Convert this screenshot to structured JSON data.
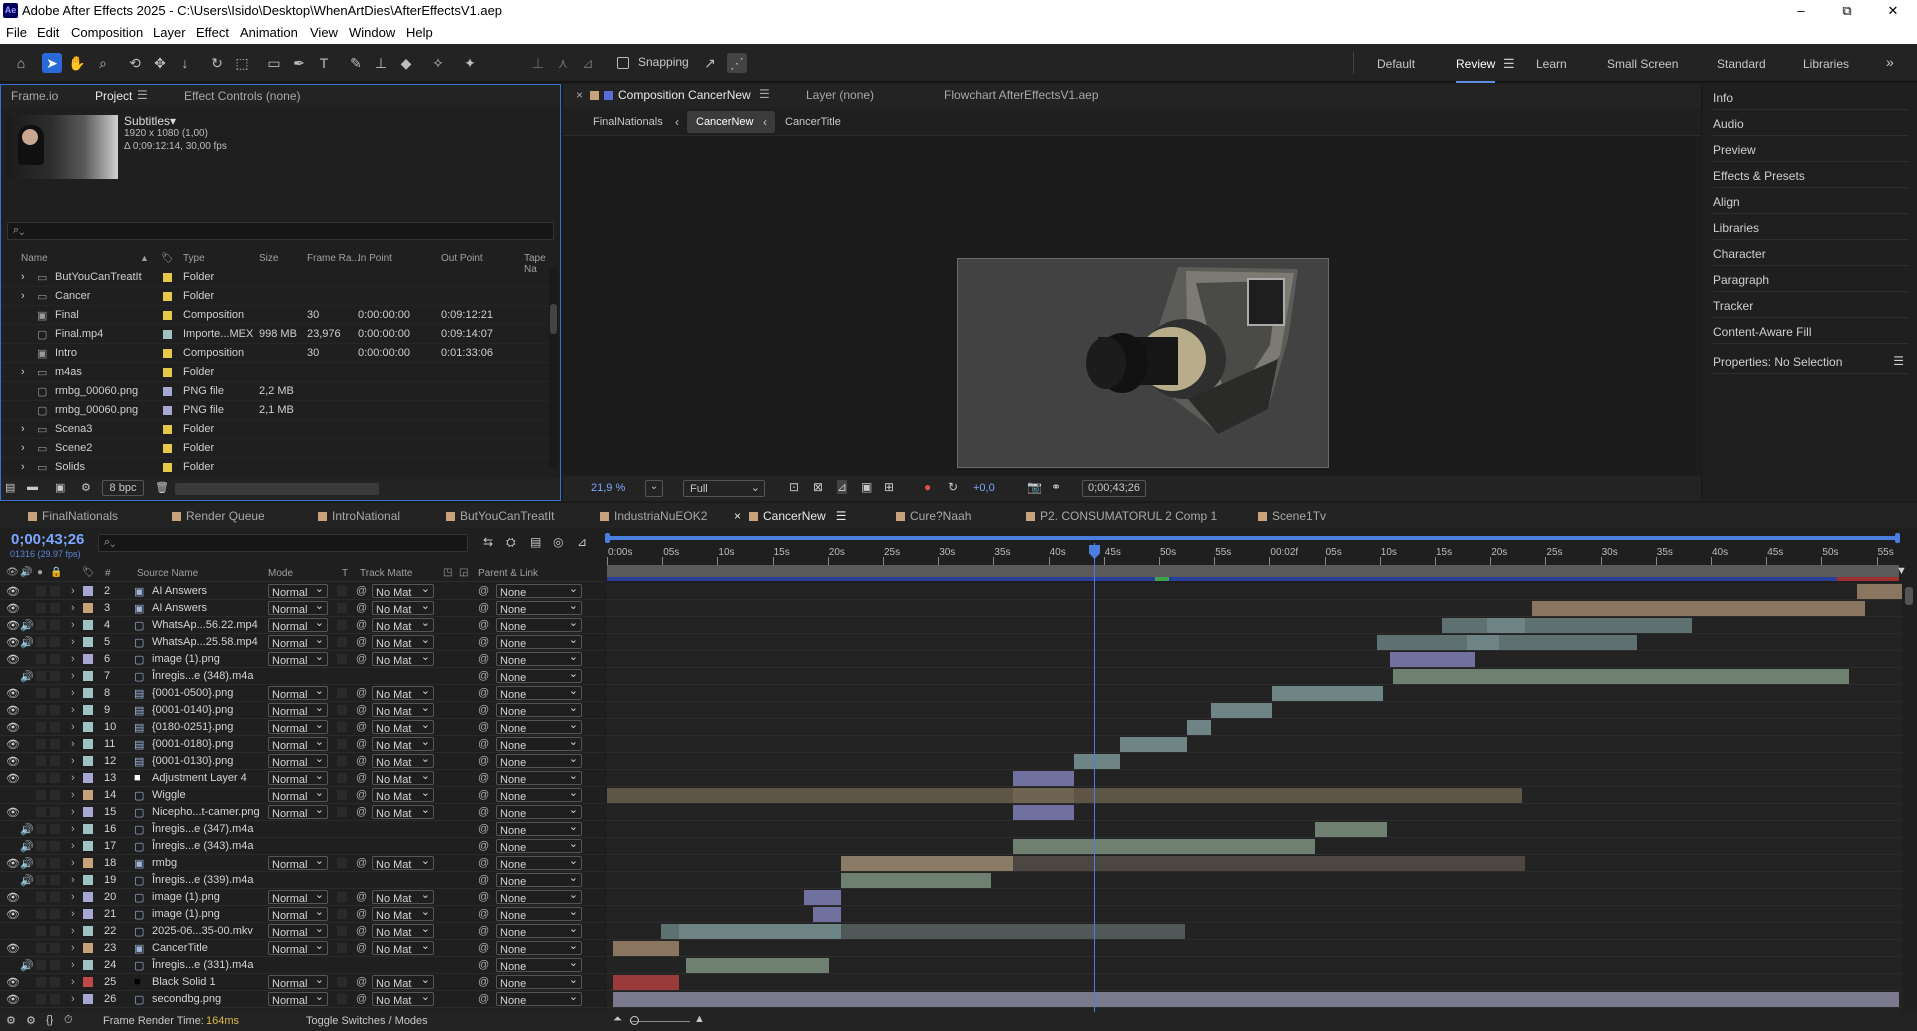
{
  "window": {
    "title": "Adobe After Effects 2025 - C:\\Users\\Isido\\Desktop\\WhenArtDies\\AfterEffectsV1.aep",
    "logo": "Ae",
    "minimize": "–",
    "maximize": "⧉",
    "close": "✕"
  },
  "menu": [
    "File",
    "Edit",
    "Composition",
    "Layer",
    "Effect",
    "Animation",
    "View",
    "Window",
    "Help"
  ],
  "toolbar": {
    "snapping": "Snapping",
    "workspaces": [
      "Default",
      "Review",
      "Learn",
      "Small Screen",
      "Standard",
      "Libraries"
    ],
    "active_workspace": "Review",
    "more": "»"
  },
  "project_panel": {
    "tabs": [
      "Frame.io",
      "Project",
      "Effect Controls (none)"
    ],
    "active_tab": "Project",
    "item_name": "Subtitles▾",
    "item_info1": "1920 x 1080 (1,00)",
    "item_info2": "Δ 0;09:12:14, 30,00 fps",
    "search_placeholder": "",
    "columns": [
      "Name",
      "Type",
      "Size",
      "Frame Ra...",
      "In Point",
      "Out Point",
      "Tape Na"
    ],
    "rows": [
      {
        "name": "ButYouCanTreatIt",
        "type": "Folder",
        "size": "",
        "fr": "",
        "in": "",
        "out": "",
        "icon": "folder",
        "label": "#e8c84a",
        "expand": true
      },
      {
        "name": "Cancer",
        "type": "Folder",
        "size": "",
        "fr": "",
        "in": "",
        "out": "",
        "icon": "folder",
        "label": "#e8c84a",
        "expand": true
      },
      {
        "name": "Final",
        "type": "Composition",
        "size": "",
        "fr": "30",
        "in": "0:00:00:00",
        "out": "0:09:12:21",
        "icon": "comp",
        "label": "#e8c84a",
        "expand": false
      },
      {
        "name": "Final.mp4",
        "type": "Importe...MEX",
        "size": "998 MB",
        "fr": "23,976",
        "in": "0:00:00:00",
        "out": "0:09:14:07",
        "icon": "file",
        "label": "#9fc3c3",
        "expand": false
      },
      {
        "name": "Intro",
        "type": "Composition",
        "size": "",
        "fr": "30",
        "in": "0:00:00:00",
        "out": "0:01:33:06",
        "icon": "comp",
        "label": "#e8c84a",
        "expand": false
      },
      {
        "name": "m4as",
        "type": "Folder",
        "size": "",
        "fr": "",
        "in": "",
        "out": "",
        "icon": "folder",
        "label": "#e8c84a",
        "expand": true
      },
      {
        "name": "rmbg_00060.png",
        "type": "PNG file",
        "size": "2,2 MB",
        "fr": "",
        "in": "",
        "out": "",
        "icon": "png",
        "label": "#a7a7d4",
        "expand": false
      },
      {
        "name": "rmbg_00060.png",
        "type": "PNG file",
        "size": "2,1 MB",
        "fr": "",
        "in": "",
        "out": "",
        "icon": "png",
        "label": "#a7a7d4",
        "expand": false
      },
      {
        "name": "Scena3",
        "type": "Folder",
        "size": "",
        "fr": "",
        "in": "",
        "out": "",
        "icon": "folder",
        "label": "#e8c84a",
        "expand": true
      },
      {
        "name": "Scene2",
        "type": "Folder",
        "size": "",
        "fr": "",
        "in": "",
        "out": "",
        "icon": "folder",
        "label": "#e8c84a",
        "expand": true
      },
      {
        "name": "Solids",
        "type": "Folder",
        "size": "",
        "fr": "",
        "in": "",
        "out": "",
        "icon": "folder",
        "label": "#e8c84a",
        "expand": true
      }
    ],
    "bpc": "8 bpc"
  },
  "comp_panel": {
    "tab": "Composition CancerNew",
    "layer_tab": "Layer (none)",
    "flowchart_tab": "Flowchart AfterEffectsV1.aep",
    "breadcrumbs": [
      "FinalNationals",
      "CancerNew",
      "CancerTitle"
    ],
    "zoom": "21,9 %",
    "resolution": "Full",
    "exposure": "+0,0",
    "timecode": "0;00;43;26"
  },
  "right_panel": [
    "Info",
    "Audio",
    "Preview",
    "Effects & Presets",
    "Align",
    "Libraries",
    "Character",
    "Paragraph",
    "Tracker",
    "Content-Aware Fill",
    "Properties: No Selection"
  ],
  "timeline": {
    "tabs": [
      "FinalNationals",
      "Render Queue",
      "IntroNational",
      "ButYouCanTreatIt",
      "IndustriaNuEOK2",
      "CancerNew",
      "Cure?Naah",
      "P2. CONSUMATORUL 2 Comp 1",
      "Scene1Tv"
    ],
    "active_tab": "CancerNew",
    "timecode": "0;00;43;26",
    "frame_info": "01316 (29.97 fps)",
    "columns": {
      "num": "#",
      "source": "Source Name",
      "mode": "Mode",
      "t": "T",
      "matte": "Track Matte",
      "parent": "Parent & Link"
    },
    "ruler": [
      "0:00s",
      "05s",
      "10s",
      "15s",
      "20s",
      "25s",
      "30s",
      "35s",
      "40s",
      "45s",
      "50s",
      "55s",
      "00:02f",
      "05s",
      "10s",
      "15s",
      "20s",
      "25s",
      "30s",
      "35s",
      "40s",
      "45s",
      "50s",
      "55s"
    ],
    "layers": [
      {
        "n": "2",
        "name": "AI Answers",
        "mode": "Normal",
        "matte": "No Mat",
        "parent": "None",
        "label": "#a7a7d4",
        "icon": "comp",
        "eye": true,
        "aud": false
      },
      {
        "n": "3",
        "name": "AI Answers",
        "mode": "Normal",
        "matte": "No Mat",
        "parent": "None",
        "label": "#c8a27a",
        "icon": "comp",
        "eye": true,
        "aud": false
      },
      {
        "n": "4",
        "name": "WhatsAp...56.22.mp4",
        "mode": "Normal",
        "matte": "No Mat",
        "parent": "None",
        "label": "#9fc3c3",
        "icon": "file",
        "eye": true,
        "aud": true
      },
      {
        "n": "5",
        "name": "WhatsAp...25.58.mp4",
        "mode": "Normal",
        "matte": "No Mat",
        "parent": "None",
        "label": "#9fc3c3",
        "icon": "file",
        "eye": true,
        "aud": true
      },
      {
        "n": "6",
        "name": "image (1).png",
        "mode": "Normal",
        "matte": "No Mat",
        "parent": "None",
        "label": "#a7a7d4",
        "icon": "png",
        "eye": true,
        "aud": false
      },
      {
        "n": "7",
        "name": "Înregis...e (348).m4a",
        "mode": "",
        "matte": "",
        "parent": "None",
        "label": "#9fc3c3",
        "icon": "file",
        "eye": false,
        "aud": true
      },
      {
        "n": "8",
        "name": "{0001-0500}.png",
        "mode": "Normal",
        "matte": "No Mat",
        "parent": "None",
        "label": "#9fc3c3",
        "icon": "seq",
        "eye": true,
        "aud": false
      },
      {
        "n": "9",
        "name": "{0001-0140}.png",
        "mode": "Normal",
        "matte": "No Mat",
        "parent": "None",
        "label": "#9fc3c3",
        "icon": "seq",
        "eye": true,
        "aud": false
      },
      {
        "n": "10",
        "name": "{0180-0251}.png",
        "mode": "Normal",
        "matte": "No Mat",
        "parent": "None",
        "label": "#9fc3c3",
        "icon": "seq",
        "eye": true,
        "aud": false
      },
      {
        "n": "11",
        "name": "{0001-0180}.png",
        "mode": "Normal",
        "matte": "No Mat",
        "parent": "None",
        "label": "#9fc3c3",
        "icon": "seq",
        "eye": true,
        "aud": false
      },
      {
        "n": "12",
        "name": "{0001-0130}.png",
        "mode": "Normal",
        "matte": "No Mat",
        "parent": "None",
        "label": "#9fc3c3",
        "icon": "seq",
        "eye": true,
        "aud": false
      },
      {
        "n": "13",
        "name": "Adjustment Layer 4",
        "mode": "Normal",
        "matte": "No Mat",
        "parent": "None",
        "label": "#a7a7d4",
        "icon": "solid",
        "eye": true,
        "aud": false
      },
      {
        "n": "14",
        "name": "Wiggle",
        "mode": "Normal",
        "matte": "No Mat",
        "parent": "None",
        "label": "#c8a27a",
        "icon": "null",
        "eye": false,
        "aud": false
      },
      {
        "n": "15",
        "name": "Nicepho...t-camer.png",
        "mode": "Normal",
        "matte": "No Mat",
        "parent": "None",
        "label": "#a7a7d4",
        "icon": "png",
        "eye": true,
        "aud": false
      },
      {
        "n": "16",
        "name": "Înregis...e (347).m4a",
        "mode": "",
        "matte": "",
        "parent": "None",
        "label": "#9fc3c3",
        "icon": "file",
        "eye": false,
        "aud": true
      },
      {
        "n": "17",
        "name": "Înregis...e (343).m4a",
        "mode": "",
        "matte": "",
        "parent": "None",
        "label": "#9fc3c3",
        "icon": "file",
        "eye": false,
        "aud": true
      },
      {
        "n": "18",
        "name": "rmbg",
        "mode": "Normal",
        "matte": "No Mat",
        "parent": "None",
        "label": "#c8a27a",
        "icon": "comp",
        "eye": true,
        "aud": true
      },
      {
        "n": "19",
        "name": "Înregis...e (339).m4a",
        "mode": "",
        "matte": "",
        "parent": "None",
        "label": "#9fc3c3",
        "icon": "file",
        "eye": false,
        "aud": true
      },
      {
        "n": "20",
        "name": "image (1).png",
        "mode": "Normal",
        "matte": "No Mat",
        "parent": "None",
        "label": "#a7a7d4",
        "icon": "png",
        "eye": true,
        "aud": false
      },
      {
        "n": "21",
        "name": "image (1).png",
        "mode": "Normal",
        "matte": "No Mat",
        "parent": "None",
        "label": "#a7a7d4",
        "icon": "png",
        "eye": true,
        "aud": false
      },
      {
        "n": "22",
        "name": "2025-06...35-00.mkv",
        "mode": "Normal",
        "matte": "No Mat",
        "parent": "None",
        "label": "#9fc3c3",
        "icon": "file",
        "eye": false,
        "aud": false
      },
      {
        "n": "23",
        "name": "CancerTitle",
        "mode": "Normal",
        "matte": "No Mat",
        "parent": "None",
        "label": "#c8a27a",
        "icon": "comp",
        "eye": true,
        "aud": false
      },
      {
        "n": "24",
        "name": "Înregis...e (331).m4a",
        "mode": "",
        "matte": "",
        "parent": "None",
        "label": "#9fc3c3",
        "icon": "file",
        "eye": false,
        "aud": true
      },
      {
        "n": "25",
        "name": "Black Solid 1",
        "mode": "Normal",
        "matte": "No Mat",
        "parent": "None",
        "label": "#c04848",
        "icon": "black",
        "eye": true,
        "aud": false
      },
      {
        "n": "26",
        "name": "secondbg.png",
        "mode": "Normal",
        "matte": "No Mat",
        "parent": "None",
        "label": "#a7a7d4",
        "icon": "png",
        "eye": true,
        "aud": false
      }
    ],
    "footer": {
      "render_label": "Frame Render Time:",
      "render_value": "164ms",
      "toggle": "Toggle Switches / Modes"
    }
  }
}
